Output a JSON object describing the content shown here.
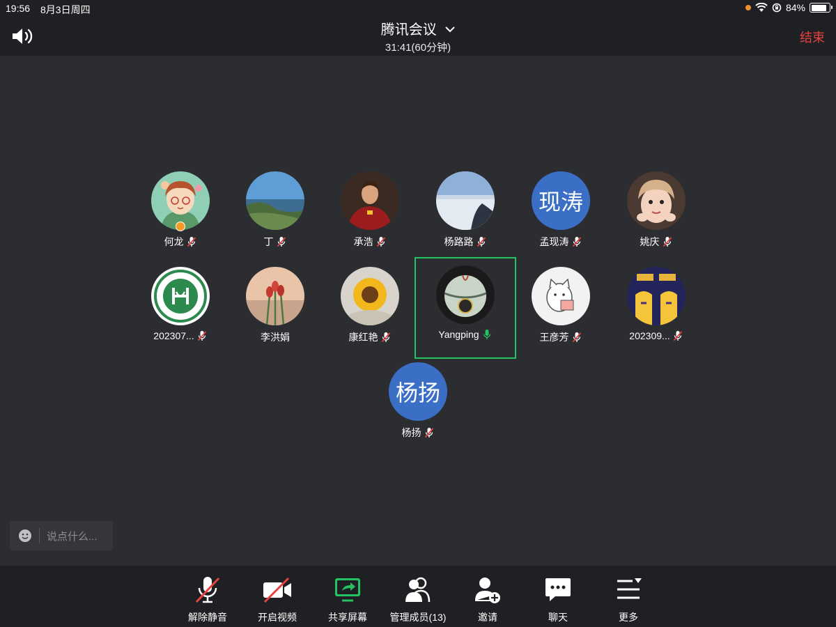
{
  "status_bar": {
    "time": "19:56",
    "date": "8月3日周四",
    "battery": "84%",
    "battery_level": 0.84
  },
  "header": {
    "title": "腾讯会议",
    "subtitle": "31:41(60分钟)",
    "end_label": "结束"
  },
  "participants": [
    {
      "name": "何龙",
      "mic": "muted",
      "avatar": "cartoon-boy"
    },
    {
      "name": "丁",
      "mic": "muted",
      "avatar": "sea-cliff"
    },
    {
      "name": "承浩",
      "mic": "muted",
      "avatar": "soccer-player"
    },
    {
      "name": "杨路路",
      "mic": "muted",
      "avatar": "snow-mountain"
    },
    {
      "name": "孟现涛",
      "mic": "muted",
      "avatar_text": "现涛"
    },
    {
      "name": "姚庆",
      "mic": "muted",
      "avatar": "child-photo"
    },
    {
      "name": "202307...",
      "mic": "muted",
      "avatar": "university-logo"
    },
    {
      "name": "李洪娟",
      "mic": "none",
      "avatar": "tulips"
    },
    {
      "name": "康红艳",
      "mic": "muted",
      "avatar": "sunflower"
    },
    {
      "name": "Yangping",
      "mic": "active",
      "avatar": "vase"
    },
    {
      "name": "王彦芳",
      "mic": "muted",
      "avatar": "cartoon-cat"
    },
    {
      "name": "202309...",
      "mic": "muted",
      "avatar": "basketball-jerseys"
    },
    {
      "name": "杨扬",
      "mic": "muted",
      "avatar_text": "杨扬"
    }
  ],
  "chat": {
    "placeholder": "说点什么..."
  },
  "toolbar": {
    "unmute": "解除静音",
    "start_video": "开启视频",
    "share_screen": "共享屏幕",
    "manage_members": "管理成员(13)",
    "invite": "邀请",
    "chat": "聊天",
    "more": "更多"
  },
  "colors": {
    "background": "#2b2d31",
    "bar": "#1f2023",
    "end_red": "#e64340",
    "active_green": "#26c262",
    "share_green": "#26c262",
    "avatar_blue": "#3b6fc6",
    "mute_red": "#e64340"
  }
}
